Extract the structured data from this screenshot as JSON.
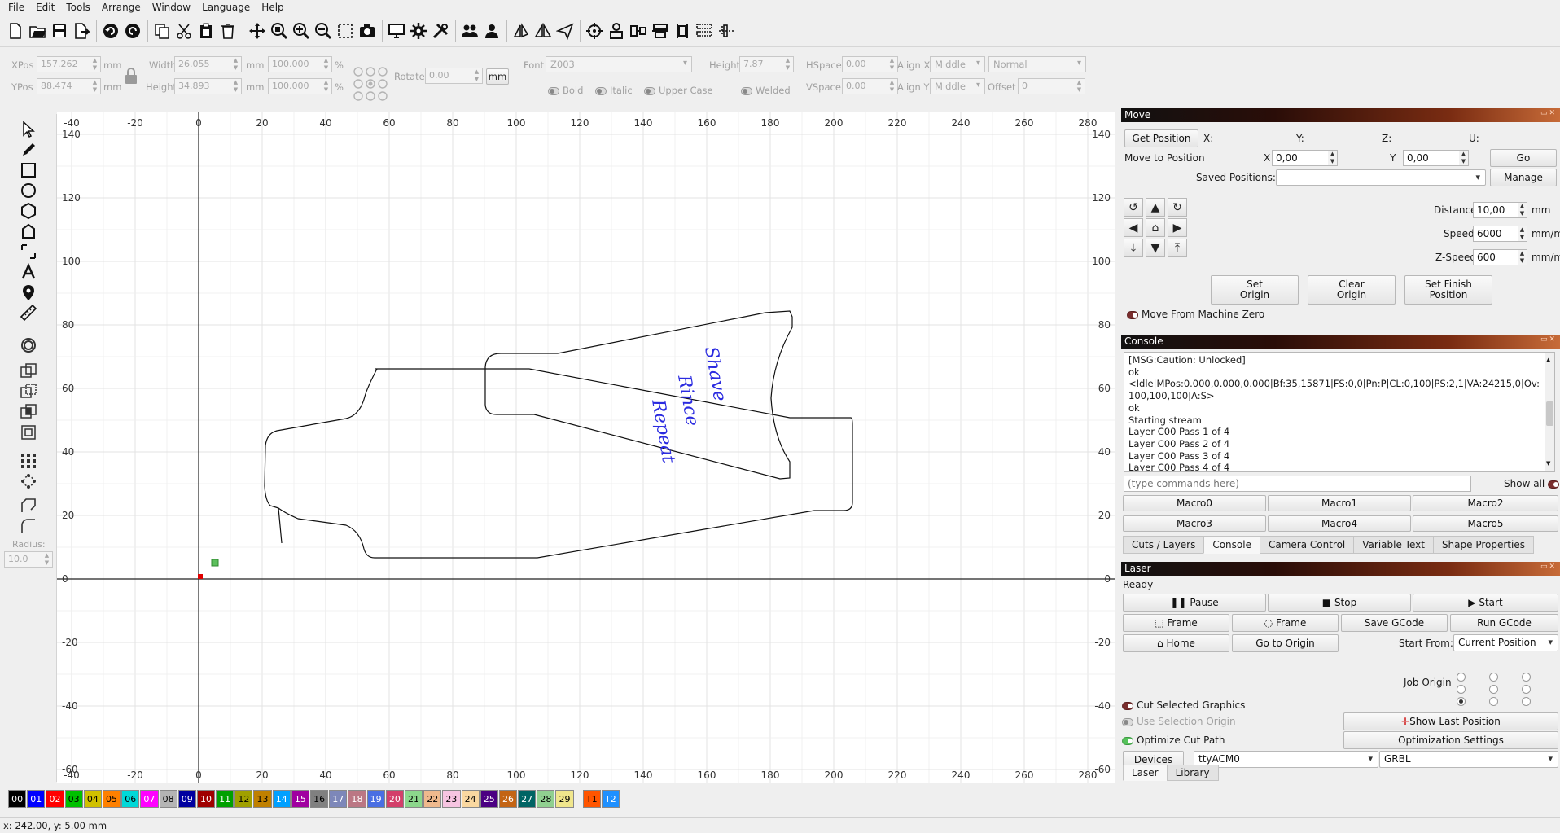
{
  "menu": [
    "File",
    "Edit",
    "Tools",
    "Arrange",
    "Window",
    "Language",
    "Help"
  ],
  "toolbar_icons": [
    "new-file",
    "open-file",
    "save-file",
    "export-file",
    "undo",
    "redo",
    "copy",
    "cut",
    "paste",
    "delete",
    "move",
    "zoom-fit",
    "zoom-in",
    "zoom-out",
    "select-rect",
    "camera",
    "monitor",
    "settings",
    "tools",
    "group",
    "ungroup",
    "mirror-h",
    "mirror-v",
    "rotate",
    "target",
    "align-center",
    "align-h",
    "align-v",
    "distribute",
    "distribute-v",
    "dock"
  ],
  "props": {
    "xpos_label": "XPos",
    "xpos": "157.262",
    "ypos_label": "YPos",
    "ypos": "88.474",
    "mm": "mm",
    "width_label": "Width",
    "width": "26.055",
    "height_label": "Height",
    "height": "34.893",
    "pct_w": "100.000",
    "pct_h": "100.000",
    "pct": "%",
    "rotate_label": "Rotate",
    "rotate": "0.00",
    "unit_button": "mm",
    "font_label": "Font",
    "font": "Z003",
    "text_height_label": "Height",
    "text_height": "7.87",
    "hspace_label": "HSpace",
    "hspace": "0.00",
    "vspace_label": "VSpace",
    "vspace": "0.00",
    "alignx_label": "Align X",
    "alignx": "Middle",
    "aligny_label": "Align Y",
    "aligny": "Middle",
    "style": "Normal",
    "offset_label": "Offset",
    "offset": "0",
    "bold": "Bold",
    "italic": "Italic",
    "upper": "Upper Case",
    "welded": "Welded"
  },
  "left_tools": {
    "radius_label": "Radius:",
    "radius": "10.0"
  },
  "ruler": {
    "x_ticks": [
      "-40",
      "-20",
      "0",
      "20",
      "40",
      "60",
      "80",
      "100",
      "120",
      "140",
      "160",
      "180",
      "200",
      "220",
      "240",
      "260",
      "280"
    ],
    "y_ticks": [
      "140",
      "120",
      "100",
      "80",
      "60",
      "40",
      "20",
      "0",
      "-20",
      "-40",
      "-60"
    ]
  },
  "canvas_text": [
    "Shave",
    "Rince",
    "Repeat"
  ],
  "move": {
    "title": "Move",
    "get_position": "Get Position",
    "x": "X:",
    "y": "Y:",
    "z": "Z:",
    "u": "U:",
    "move_to_position": "Move to Position",
    "mx_label": "X",
    "mx": "0,00",
    "my_label": "Y",
    "my": "0,00",
    "go": "Go",
    "saved_positions": "Saved Positions:",
    "manage": "Manage",
    "distance_label": "Distance",
    "distance": "10,00",
    "distance_unit": "mm",
    "speed_label": "Speed",
    "speed": "6000",
    "speed_unit": "mm/m",
    "zspeed_label": "Z-Speed",
    "zspeed": "600",
    "zspeed_unit": "mm/m",
    "set_origin": "Set\nOrigin",
    "clear_origin": "Clear\nOrigin",
    "set_finish": "Set Finish\nPosition",
    "move_from_zero": "Move From Machine Zero"
  },
  "console": {
    "title": "Console",
    "lines": [
      "[MSG:Caution: Unlocked]",
      "ok",
      "<Idle|MPos:0.000,0.000,0.000|Bf:35,15871|FS:0,0|Pn:P|CL:0,100|PS:2,1|VA:24215,0|Ov:\n100,100,100|A:S>",
      "ok",
      "Starting stream",
      "Layer C00 Pass 1 of 4",
      "Layer C00 Pass 2 of 4",
      "Layer C00 Pass 3 of 4",
      "Layer C00 Pass 4 of 4"
    ],
    "placeholder": "(type commands here)",
    "show_all": "Show all",
    "macros": [
      "Macro0",
      "Macro1",
      "Macro2",
      "Macro3",
      "Macro4",
      "Macro5"
    ],
    "tabs": [
      "Cuts / Layers",
      "Console",
      "Camera Control",
      "Variable Text",
      "Shape Properties"
    ]
  },
  "laser": {
    "title": "Laser",
    "status": "Ready",
    "pause": "Pause",
    "stop": "Stop",
    "start": "Start",
    "frame1": "Frame",
    "frame2": "Frame",
    "save_gcode": "Save GCode",
    "run_gcode": "Run GCode",
    "home": "Home",
    "go_to_origin": "Go to Origin",
    "start_from_label": "Start From:",
    "start_from": "Current Position",
    "job_origin": "Job Origin",
    "cut_selected": "Cut Selected Graphics",
    "use_selection_origin": "Use Selection Origin",
    "show_last_position": "Show Last Position",
    "optimize_cut": "Optimize Cut Path",
    "optimization_settings": "Optimization Settings",
    "devices": "Devices",
    "port": "ttyACM0",
    "controller": "GRBL",
    "bottom_tabs": [
      "Laser",
      "Library"
    ]
  },
  "palette": [
    {
      "label": "00",
      "color": "#000000",
      "fg": "#ffffff"
    },
    {
      "label": "01",
      "color": "#0000ff",
      "fg": "#ffffff"
    },
    {
      "label": "02",
      "color": "#ff0000",
      "fg": "#ffffff"
    },
    {
      "label": "03",
      "color": "#00c000",
      "fg": "#000000"
    },
    {
      "label": "04",
      "color": "#d0c000",
      "fg": "#000000"
    },
    {
      "label": "05",
      "color": "#ff8000",
      "fg": "#000000"
    },
    {
      "label": "06",
      "color": "#00d8d8",
      "fg": "#000000"
    },
    {
      "label": "07",
      "color": "#ff00ff",
      "fg": "#ffffff"
    },
    {
      "label": "08",
      "color": "#b4b4b4",
      "fg": "#000000"
    },
    {
      "label": "09",
      "color": "#0000a0",
      "fg": "#ffffff"
    },
    {
      "label": "10",
      "color": "#a00000",
      "fg": "#ffffff"
    },
    {
      "label": "11",
      "color": "#00a000",
      "fg": "#ffffff"
    },
    {
      "label": "12",
      "color": "#a0a000",
      "fg": "#000000"
    },
    {
      "label": "13",
      "color": "#c08000",
      "fg": "#000000"
    },
    {
      "label": "14",
      "color": "#00a0ff",
      "fg": "#ffffff"
    },
    {
      "label": "15",
      "color": "#a000a0",
      "fg": "#ffffff"
    },
    {
      "label": "16",
      "color": "#808080",
      "fg": "#000000"
    },
    {
      "label": "17",
      "color": "#7d87b9",
      "fg": "#ffffff"
    },
    {
      "label": "18",
      "color": "#bb7784",
      "fg": "#ffffff"
    },
    {
      "label": "19",
      "color": "#4a6fe3",
      "fg": "#ffffff"
    },
    {
      "label": "20",
      "color": "#d33f6a",
      "fg": "#ffffff"
    },
    {
      "label": "21",
      "color": "#8cd78c",
      "fg": "#000000"
    },
    {
      "label": "22",
      "color": "#f0b98d",
      "fg": "#000000"
    },
    {
      "label": "23",
      "color": "#f6c4e1",
      "fg": "#000000"
    },
    {
      "label": "24",
      "color": "#fad8a0",
      "fg": "#000000"
    },
    {
      "label": "25",
      "color": "#4b0082",
      "fg": "#ffffff"
    },
    {
      "label": "26",
      "color": "#c36414",
      "fg": "#ffffff"
    },
    {
      "label": "27",
      "color": "#006464",
      "fg": "#ffffff"
    },
    {
      "label": "28",
      "color": "#90d090",
      "fg": "#000000"
    },
    {
      "label": "29",
      "color": "#f0e68c",
      "fg": "#000000"
    },
    {
      "label": "T1",
      "color": "#ff5500",
      "fg": "#000000"
    },
    {
      "label": "T2",
      "color": "#1e90ff",
      "fg": "#ffffff"
    }
  ],
  "status": "x: 242.00, y: 5.00 mm"
}
